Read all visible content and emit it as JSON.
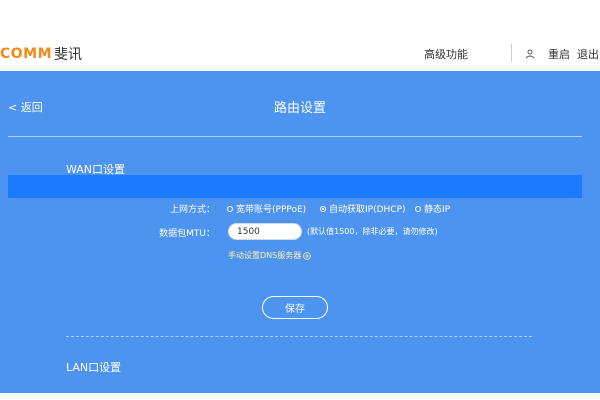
{
  "header": {
    "brand": "COMM",
    "brand_cn": "斐讯",
    "nav_advanced": "高级功能",
    "nav_restart": "重启",
    "nav_logout": "退出",
    "user_icon": "user-switch-icon"
  },
  "page": {
    "back_label": "< 返回",
    "title": "路由设置"
  },
  "wan": {
    "section_title": "WAN口设置",
    "connection_label": "上网方式：",
    "options": [
      {
        "label": "宽带账号(PPPoE)",
        "checked": false
      },
      {
        "label": "自动获取IP(DHCP)",
        "checked": true
      },
      {
        "label": "静态IP",
        "checked": false
      }
    ],
    "mtu_label": "数据包MTU：",
    "mtu_value": "1500",
    "mtu_hint": "(默认值1500，除非必要，请勿修改)",
    "dns_link": "手动设置DNS服务器",
    "dns_icon": "plus-circle-icon"
  },
  "actions": {
    "save_label": "保存"
  },
  "lan": {
    "section_title": "LAN口设置"
  },
  "colors": {
    "main_bg": "#4d94f0",
    "highlight": "#1a7bff",
    "brand": "#f28a1a",
    "dns_link": "#fff3b0"
  }
}
